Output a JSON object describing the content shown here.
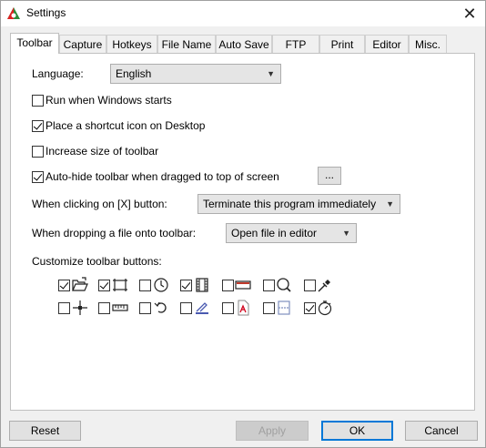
{
  "window": {
    "title": "Settings"
  },
  "tabs": [
    {
      "label": "Toolbar",
      "active": true
    },
    {
      "label": "Capture"
    },
    {
      "label": "Hotkeys"
    },
    {
      "label": "File Name"
    },
    {
      "label": "Auto Save"
    },
    {
      "label": "FTP"
    },
    {
      "label": "Print"
    },
    {
      "label": "Editor"
    },
    {
      "label": "Misc."
    }
  ],
  "toolbar": {
    "language_label": "Language:",
    "language_value": "English",
    "options": [
      {
        "label": "Run when Windows starts",
        "checked": false
      },
      {
        "label": "Place a shortcut icon on Desktop",
        "checked": true
      },
      {
        "label": "Increase size of toolbar",
        "checked": false
      },
      {
        "label": "Auto-hide toolbar when dragged to top of screen",
        "checked": true
      }
    ],
    "dots_label": "...",
    "close_click_label": "When clicking on [X] button:",
    "close_click_value": "Terminate this program immediately",
    "drop_label": "When dropping a file onto toolbar:",
    "drop_value": "Open file in editor",
    "customize_label": "Customize toolbar buttons:",
    "buttons_row1": [
      {
        "icon": "open-folder-icon",
        "checked": true
      },
      {
        "icon": "rectangle-capture-icon",
        "checked": true
      },
      {
        "icon": "timer-clock-icon",
        "checked": false
      },
      {
        "icon": "film-strip-icon",
        "checked": true
      },
      {
        "icon": "window-bar-icon",
        "checked": false
      },
      {
        "icon": "magnifier-icon",
        "checked": false
      },
      {
        "icon": "color-picker-icon",
        "checked": false
      }
    ],
    "buttons_row2": [
      {
        "icon": "crosshair-icon",
        "checked": false
      },
      {
        "icon": "ruler-icon",
        "checked": false
      },
      {
        "icon": "undo-arrow-icon",
        "checked": false
      },
      {
        "icon": "scanner-icon",
        "checked": false
      },
      {
        "icon": "pdf-icon",
        "checked": false
      },
      {
        "icon": "scroll-capture-icon",
        "checked": false
      },
      {
        "icon": "stopwatch-icon",
        "checked": true
      }
    ]
  },
  "footer": {
    "reset": "Reset",
    "apply": "Apply",
    "ok": "OK",
    "cancel": "Cancel"
  }
}
